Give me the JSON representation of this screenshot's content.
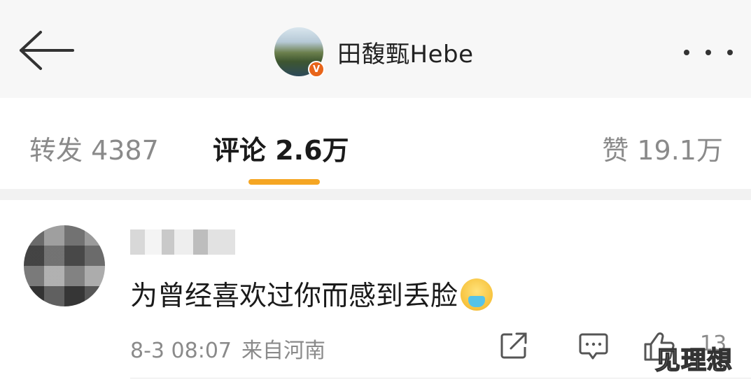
{
  "header": {
    "back_icon": "arrow-left-icon",
    "username": "田馥甄Hebe",
    "verified_icon": "verified-v-icon",
    "more_icon": "more-dots-icon"
  },
  "tabs": {
    "repost_label": "转发 4387",
    "comment_label": "评论 2.6万",
    "like_label": "赞 19.1万",
    "active": "comment",
    "accent": "#f5a623"
  },
  "comment": {
    "text": "为曾经喜欢过你而感到丢脸",
    "emoji": "😫",
    "time": "8-3 08:07",
    "location": "来自河南",
    "like_count": "13",
    "share_icon": "share-external-icon",
    "reply_icon": "comment-bubble-icon",
    "like_icon": "thumbs-up-icon"
  },
  "watermark": "见理想"
}
